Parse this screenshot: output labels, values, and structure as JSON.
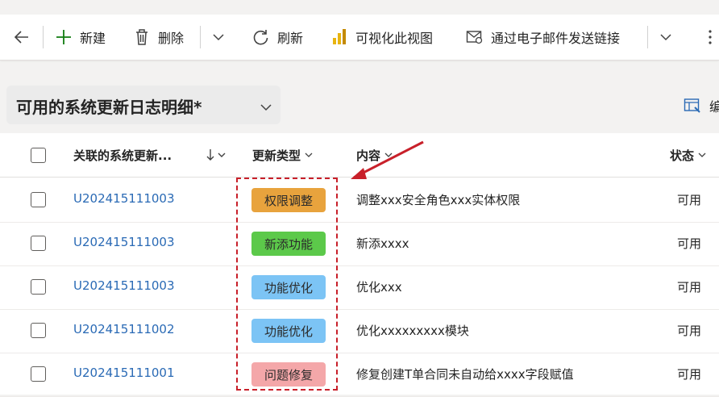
{
  "toolbar": {
    "new_label": "新建",
    "delete_label": "删除",
    "refresh_label": "刷新",
    "visualize_label": "可视化此视图",
    "email_label": "通过电子邮件发送链接"
  },
  "view": {
    "title": "可用的系统更新日志明细*",
    "edit_columns_label": "编"
  },
  "grid": {
    "columns": {
      "related": "关联的系统更新...",
      "type": "更新类型",
      "content": "内容",
      "status": "状态"
    },
    "rows": [
      {
        "id": "U202415111003",
        "type": "权限调整",
        "type_color": "#e8a33d",
        "content": "调整xxx安全角色xxx实体权限",
        "status": "可用"
      },
      {
        "id": "U202415111003",
        "type": "新添功能",
        "type_color": "#5cc94a",
        "content": "新添xxxx",
        "status": "可用"
      },
      {
        "id": "U202415111003",
        "type": "功能优化",
        "type_color": "#7cc4f5",
        "content": "优化xxx",
        "status": "可用"
      },
      {
        "id": "U202415111002",
        "type": "功能优化",
        "type_color": "#7cc4f5",
        "content": "优化xxxxxxxxx模块",
        "status": "可用"
      },
      {
        "id": "U202415111001",
        "type": "问题修复",
        "type_color": "#f4a7a9",
        "content": "修复创建T单合同未自动给xxxx字段赋值",
        "status": "可用"
      }
    ]
  },
  "colors": {
    "accent": "#2a6ab5",
    "annotation": "#c8202a",
    "new_icon": "#107c10"
  },
  "icons": [
    "back-arrow-icon",
    "plus-icon",
    "trash-icon",
    "chevron-down-icon",
    "refresh-icon",
    "bar-chart-icon",
    "email-link-icon",
    "more-icon",
    "edit-columns-icon",
    "sort-down-icon"
  ]
}
